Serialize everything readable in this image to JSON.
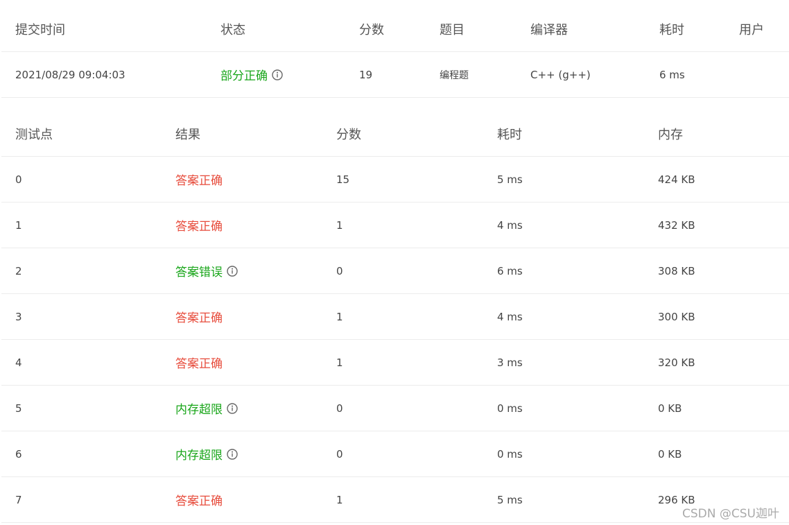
{
  "submission": {
    "headers": [
      "提交时间",
      "状态",
      "分数",
      "题目",
      "编译器",
      "耗时",
      "用户"
    ],
    "row": {
      "time": "2021/08/29 09:04:03",
      "status": "部分正确",
      "score": "19",
      "problem": "编程题",
      "compiler": "C++ (g++)",
      "duration": "6 ms",
      "user": ""
    },
    "status_color": "#19a61a"
  },
  "testcases": {
    "headers": [
      "测试点",
      "结果",
      "分数",
      "耗时",
      "内存"
    ],
    "rows": [
      {
        "id": "0",
        "result": "答案正确",
        "ok": true,
        "score": "15",
        "time": "5 ms",
        "memory": "424 KB"
      },
      {
        "id": "1",
        "result": "答案正确",
        "ok": true,
        "score": "1",
        "time": "4 ms",
        "memory": "432 KB"
      },
      {
        "id": "2",
        "result": "答案错误",
        "ok": false,
        "score": "0",
        "time": "6 ms",
        "memory": "308 KB"
      },
      {
        "id": "3",
        "result": "答案正确",
        "ok": true,
        "score": "1",
        "time": "4 ms",
        "memory": "300 KB"
      },
      {
        "id": "4",
        "result": "答案正确",
        "ok": true,
        "score": "1",
        "time": "3 ms",
        "memory": "320 KB"
      },
      {
        "id": "5",
        "result": "内存超限",
        "ok": false,
        "score": "0",
        "time": "0 ms",
        "memory": "0 KB"
      },
      {
        "id": "6",
        "result": "内存超限",
        "ok": false,
        "score": "0",
        "time": "0 ms",
        "memory": "0 KB"
      },
      {
        "id": "7",
        "result": "答案正确",
        "ok": true,
        "score": "1",
        "time": "5 ms",
        "memory": "296 KB"
      }
    ],
    "correct_color": "#e74c3c",
    "error_color": "#19a61a"
  },
  "watermark": "CSDN @CSU迦叶"
}
